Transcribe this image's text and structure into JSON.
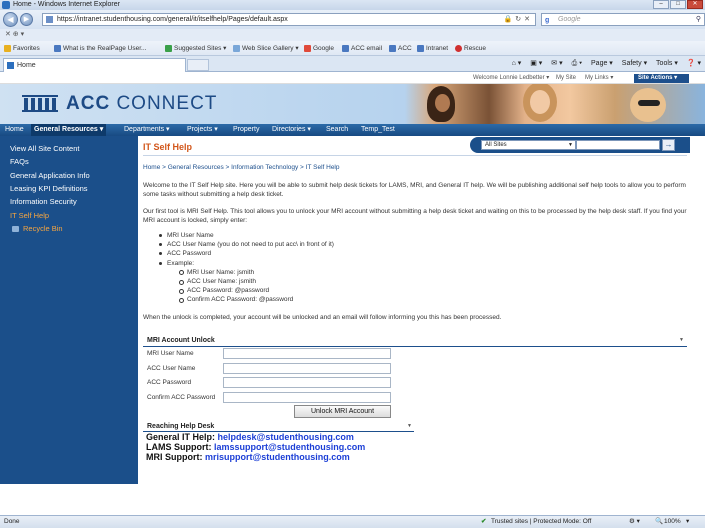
{
  "window": {
    "title": "Home - Windows Internet Explorer",
    "controls": [
      "–",
      "□",
      "✕"
    ]
  },
  "browser": {
    "url": "https://intranet.studenthousing.com/general/it/itselfhelp/Pages/default.aspx",
    "search_placeholder": "Google",
    "row3": "✕   ⊕ ▾",
    "favorites": [
      {
        "label": "Favorites",
        "icon": "star-icon",
        "color": "#e8b020"
      },
      {
        "label": "What is the RealPage User...",
        "icon": "page-icon",
        "color": "#4a78c0"
      },
      {
        "label": "Suggested Sites ▾",
        "icon": "suggested-sites-icon",
        "color": "#3aa04a"
      },
      {
        "label": "Web Slice Gallery ▾",
        "icon": "web-slice-icon",
        "color": "#7aa7d8"
      },
      {
        "label": "Google",
        "icon": "google-icon",
        "color": "#e04a3a"
      },
      {
        "label": "ACC email",
        "icon": "email-icon",
        "color": "#4a78c0"
      },
      {
        "label": "ACC",
        "icon": "acc-icon",
        "color": "#4a78c0"
      },
      {
        "label": "Intranet",
        "icon": "intranet-icon",
        "color": "#4a78c0"
      },
      {
        "label": "Rescue",
        "icon": "rescue-icon",
        "color": "#d03030"
      }
    ],
    "tab_label": "Home",
    "command_bar": [
      "⌂ ▾",
      "▣ ▾",
      "✉ ▾",
      "⎙ ▾",
      "Page ▾",
      "Safety ▾",
      "Tools ▾",
      "❓ ▾"
    ]
  },
  "sp_header": {
    "welcome": "Welcome Lonnie Ledbetter ▾",
    "my_site": "My Site",
    "my_links": "My Links ▾",
    "site_actions": "Site Actions ▾",
    "logo_text_bold": "ACC",
    "logo_text": " CONNECT"
  },
  "topnav": [
    {
      "label": "Home"
    },
    {
      "label": "General Resources ▾"
    },
    {
      "label": "Departments ▾"
    },
    {
      "label": "Projects ▾"
    },
    {
      "label": "Property"
    },
    {
      "label": "Directories ▾"
    },
    {
      "label": "Search"
    },
    {
      "label": "Temp_Test"
    }
  ],
  "leftnav": {
    "items": [
      "View All Site Content",
      "FAQs",
      "General Application Info",
      "Leasing KPI Definitions",
      "Information Security",
      "IT Self Help"
    ],
    "recycle_bin": "Recycle Bin"
  },
  "site_search": {
    "scope": "All Sites",
    "go": "→"
  },
  "page": {
    "title": "IT Self Help",
    "breadcrumb": "Home > General Resources > Information Technology > IT Self Help",
    "intro": "Welcome to the IT Self Help site.  Here you will be able to submit help desk tickets for LAMS, MRI, and General IT help.  We will be publishing additional self help tools to allow you to perform some tasks without submitting a help desk ticket.",
    "mri_para": "Our first tool is MRI Self Help.  This tool allows you to unlock your MRI account without submitting a help desk ticket and waiting on this to be processed by the help desk staff.  If you find your MRI account is locked, simply enter:",
    "bullets": [
      "MRI User Name",
      "ACC User Name (you do not need to put acc\\ in front of it)",
      "ACC Password",
      "Example:"
    ],
    "example": [
      "MRI User Name: jsmith",
      "ACC User Name: jsmith",
      "ACC Password: @password",
      "Confirm ACC Password: @password"
    ],
    "after_unlock": "When the unlock is completed, your account will be unlocked and an email will follow informing you this has been processed.",
    "unlock_header": "MRI Account Unlock",
    "fields": [
      {
        "label": "MRI User Name",
        "value": ""
      },
      {
        "label": "ACC User Name",
        "value": ""
      },
      {
        "label": "ACC Password",
        "value": ""
      },
      {
        "label": "Confirm ACC Password",
        "value": ""
      }
    ],
    "unlock_button": "Unlock MRI Account",
    "help_header": "Reaching Help Desk",
    "help_lines": [
      {
        "label": "General IT Help:",
        "email": "helpdesk@studenthousing.com"
      },
      {
        "label": "LAMS Support:",
        "email": "lamssupport@studenthousing.com"
      },
      {
        "label": "MRI Support:",
        "email": "mrisupport@studenthousing.com"
      }
    ]
  },
  "status": {
    "done": "Done",
    "zone": "Trusted sites | Protected Mode: Off",
    "zoom": "100%",
    "zoom_arrow": "▾"
  }
}
